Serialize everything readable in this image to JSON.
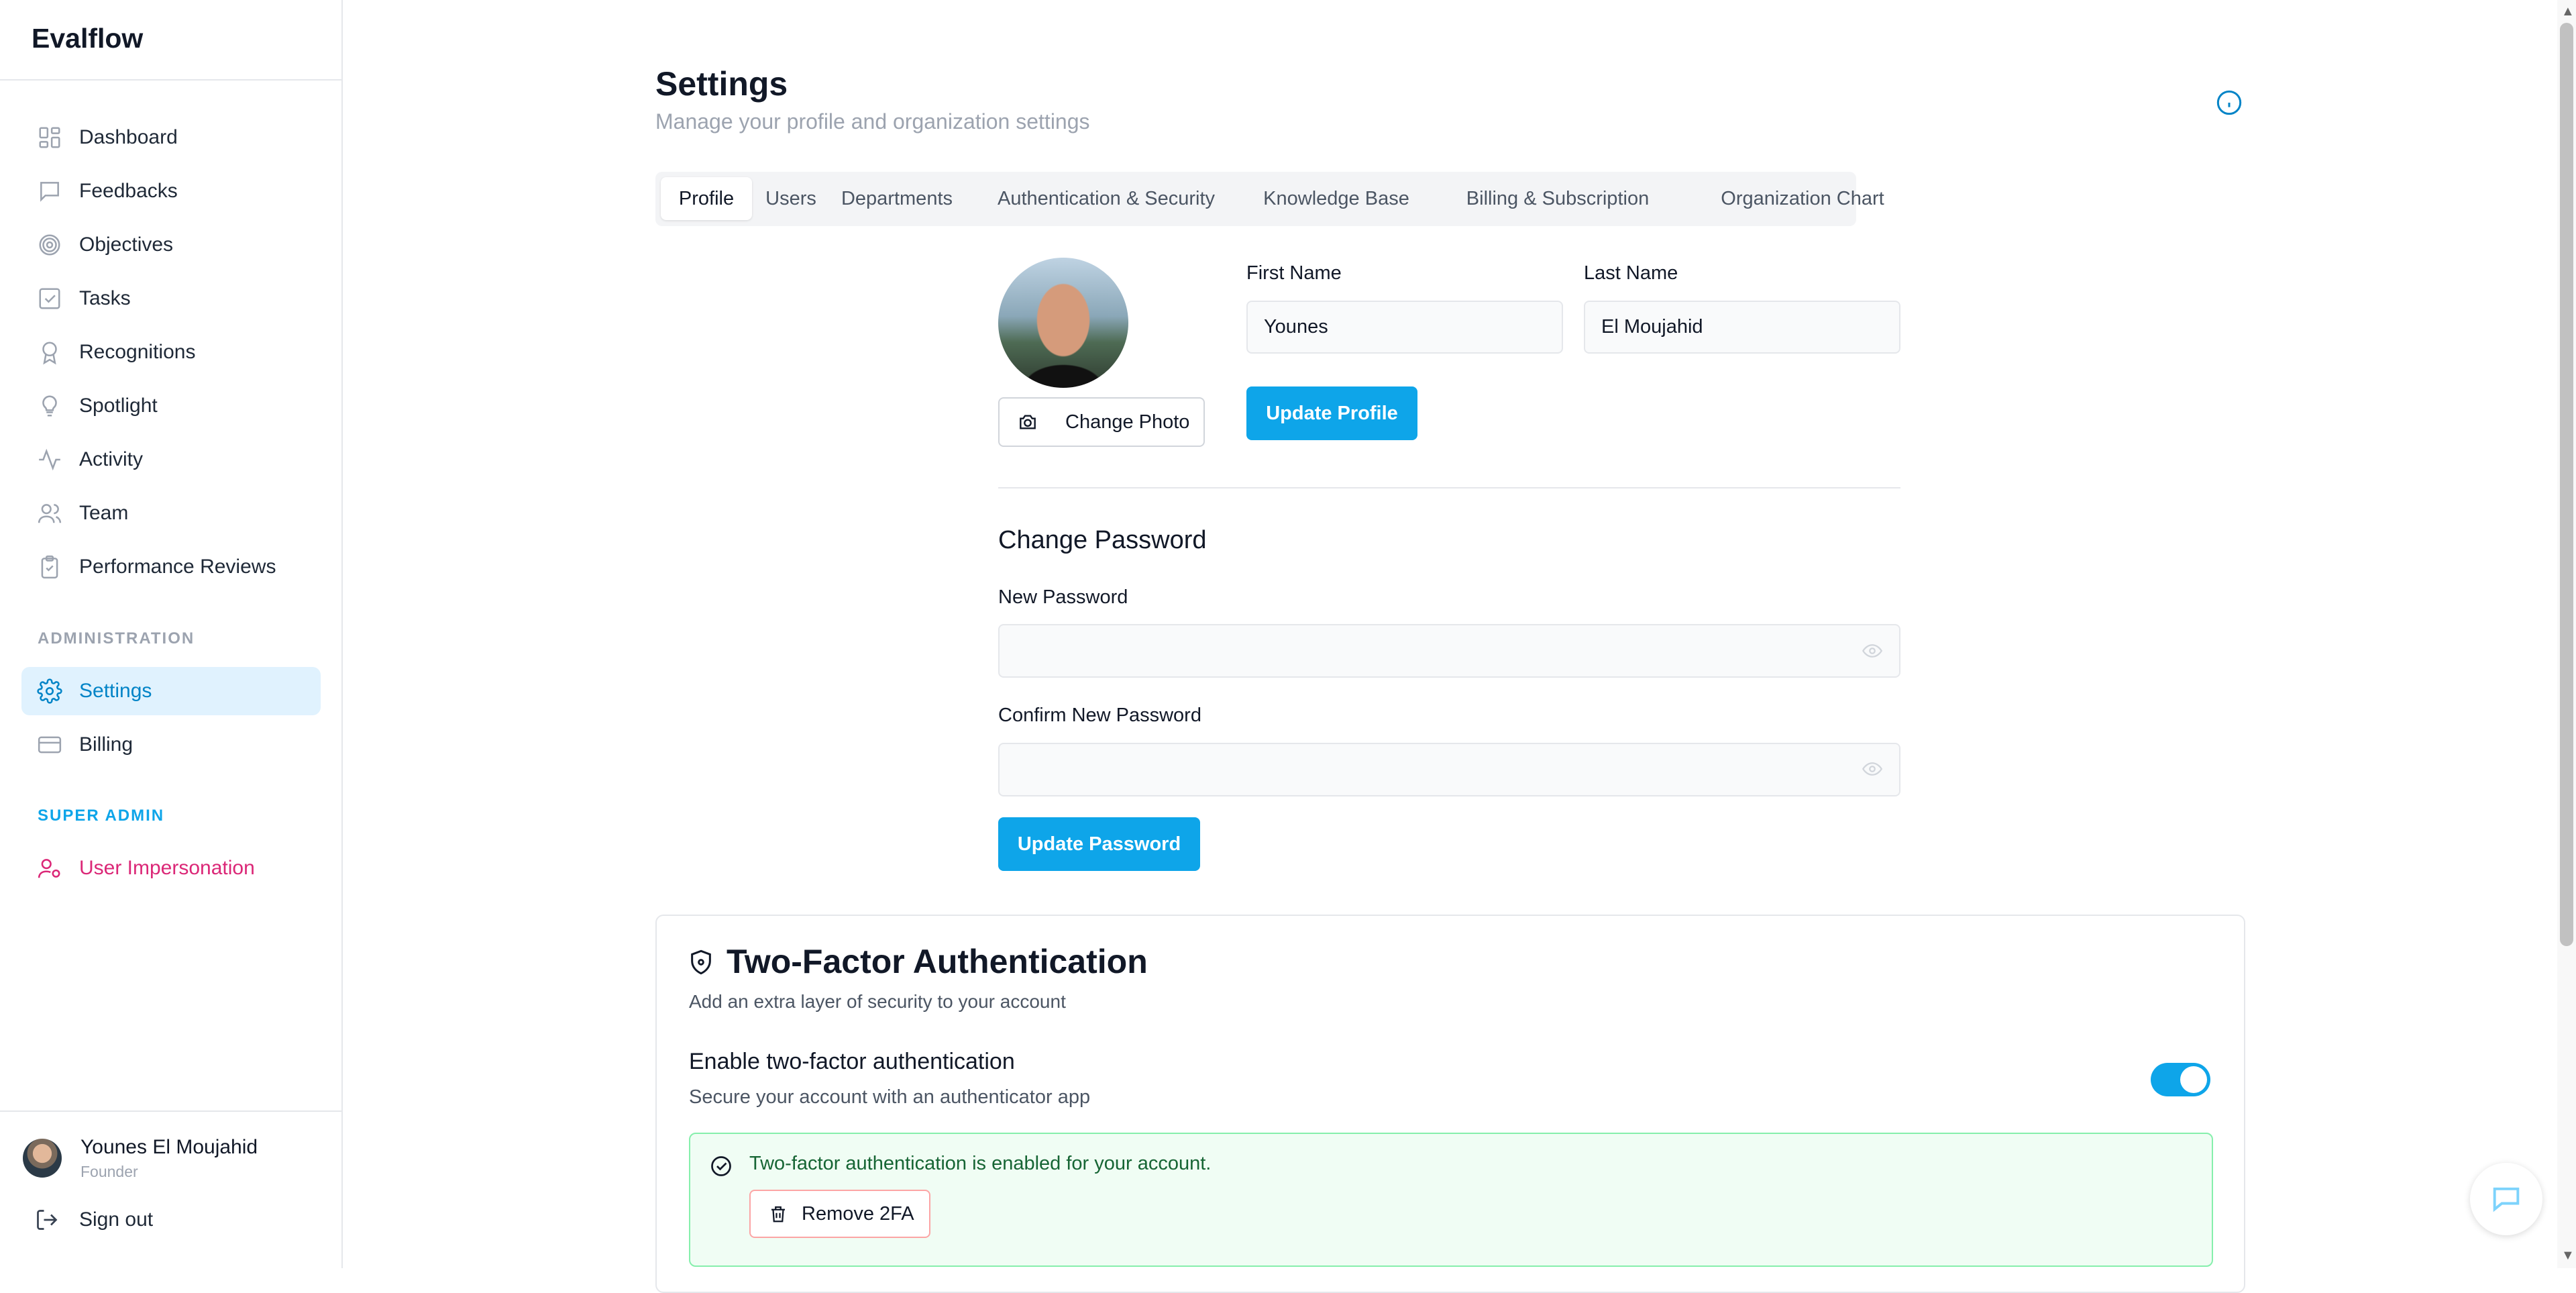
{
  "app": {
    "brand": "Evalflow"
  },
  "sidebar": {
    "items": [
      {
        "label": "Dashboard",
        "icon": "dashboard-icon"
      },
      {
        "label": "Feedbacks",
        "icon": "message-icon"
      },
      {
        "label": "Objectives",
        "icon": "target-icon"
      },
      {
        "label": "Tasks",
        "icon": "checkbox-icon"
      },
      {
        "label": "Recognitions",
        "icon": "award-icon"
      },
      {
        "label": "Spotlight",
        "icon": "lightbulb-icon"
      },
      {
        "label": "Activity",
        "icon": "activity-icon"
      },
      {
        "label": "Team",
        "icon": "users-icon"
      },
      {
        "label": "Performance Reviews",
        "icon": "clipboard-icon"
      }
    ],
    "admin_title": "ADMINISTRATION",
    "admin_items": [
      {
        "label": "Settings",
        "icon": "gear-icon",
        "active": true
      },
      {
        "label": "Billing",
        "icon": "credit-card-icon"
      }
    ],
    "super_title": "SUPER ADMIN",
    "super_items": [
      {
        "label": "User Impersonation",
        "icon": "user-cog-icon"
      }
    ],
    "user": {
      "name": "Younes El Moujahid",
      "role": "Founder"
    },
    "signout": "Sign out"
  },
  "header": {
    "title": "Settings",
    "subtitle": "Manage your profile and organization settings"
  },
  "tabs": [
    {
      "label": "Profile",
      "active": true
    },
    {
      "label": "Users"
    },
    {
      "label": "Departments"
    },
    {
      "label": "Authentication & Security"
    },
    {
      "label": "Knowledge Base"
    },
    {
      "label": "Billing & Subscription"
    },
    {
      "label": "Organization Chart"
    }
  ],
  "profile": {
    "change_photo": "Change Photo",
    "first_name_label": "First Name",
    "first_name_value": "Younes",
    "last_name_label": "Last Name",
    "last_name_value": "El Moujahid",
    "update_profile": "Update Profile"
  },
  "password": {
    "title": "Change Password",
    "new_label": "New Password",
    "new_value": "",
    "confirm_label": "Confirm New Password",
    "confirm_value": "",
    "update_button": "Update Password"
  },
  "two_factor": {
    "title": "Two-Factor Authentication",
    "subtitle": "Add an extra layer of security to your account",
    "enable_title": "Enable two-factor authentication",
    "enable_sub": "Secure your account with an authenticator app",
    "enabled": true,
    "status_message": "Two-factor authentication is enabled for your account.",
    "remove_button": "Remove 2FA"
  },
  "colors": {
    "accent": "#0ea5e9",
    "active_bg": "#e0f2fe",
    "super_admin_pink": "#db2777",
    "success_bg": "#f0fdf4",
    "success_border": "#86efac",
    "danger_border": "#fca5a5"
  }
}
